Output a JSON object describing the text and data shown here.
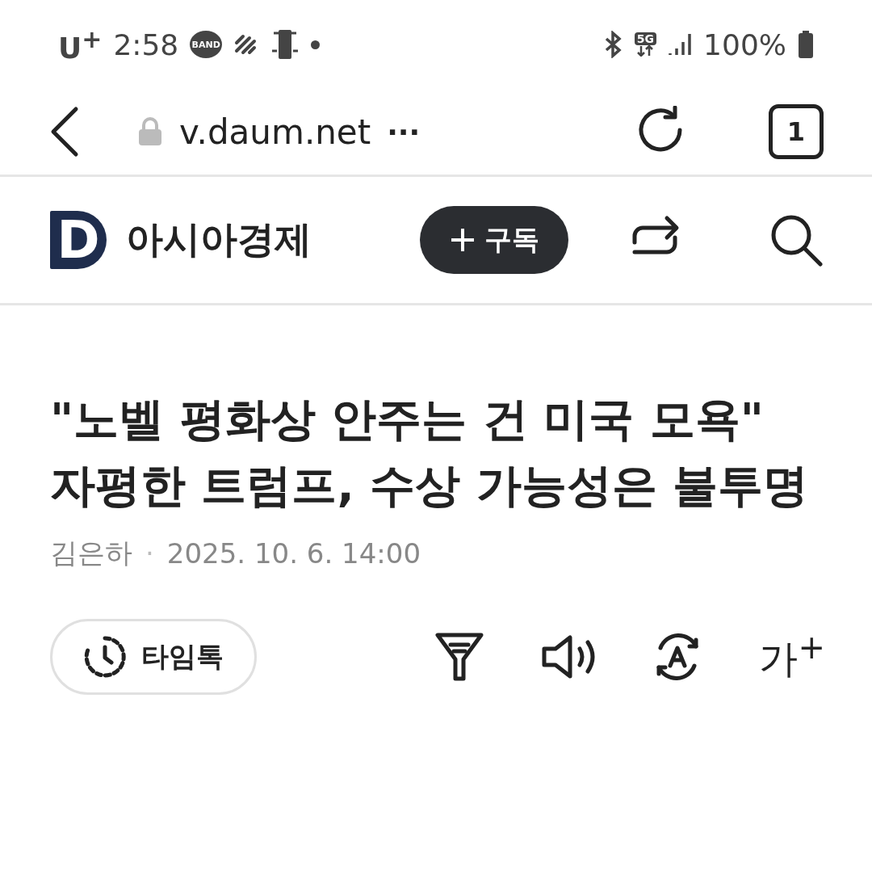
{
  "status_bar": {
    "carrier": "U$^{+}$",
    "time": "2:58",
    "band_badge": "BAND",
    "network_badge": "5G",
    "battery": "100%"
  },
  "browser_bar": {
    "url": "v.daum.net",
    "more": "···",
    "tab_count": "1"
  },
  "publisher": {
    "logo": "D",
    "name": "아시아경제",
    "subscribe": "구독"
  },
  "article": {
    "headline": "\"노벨 평화상 안주는 건 미국 모욕\" 자평한 트럼프, 수상 가능성은 불투명",
    "author": "김은하",
    "separator": "·",
    "date": "2025. 10. 6. 14:00"
  },
  "toolbar": {
    "timetalk": "타임톡",
    "font_size": "가$^{+}$"
  }
}
